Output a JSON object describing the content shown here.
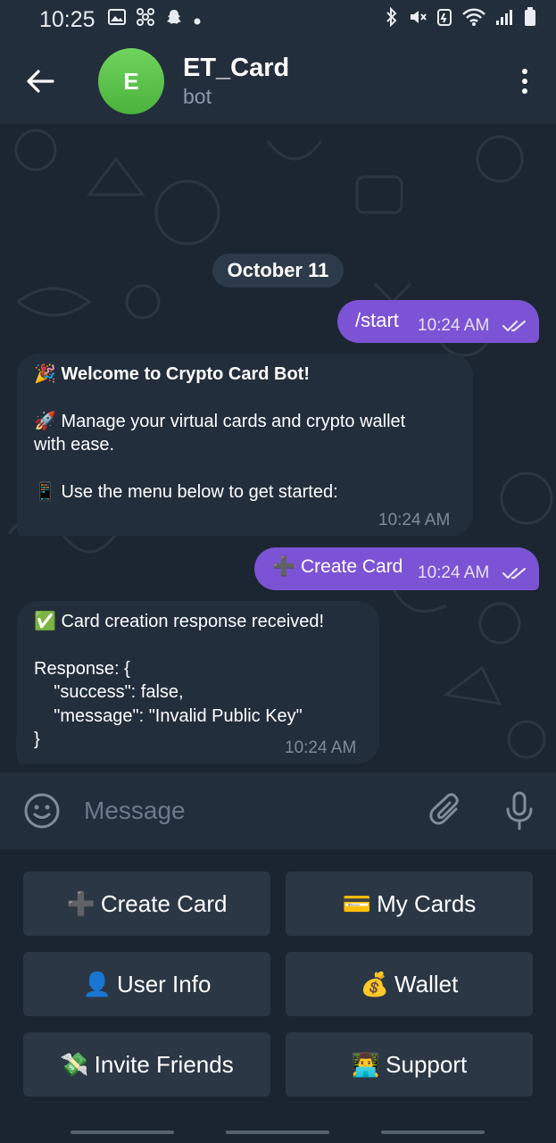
{
  "status_bar": {
    "time": "10:25",
    "left_icons": [
      "image-icon",
      "pinwheel-icon",
      "snapchat-icon",
      "dot-icon"
    ],
    "right_icons": [
      "bluetooth-icon",
      "mute-icon",
      "battery-saver-icon",
      "wifi-icon",
      "signal-icon",
      "battery-icon"
    ]
  },
  "header": {
    "avatar_letter": "E",
    "title": "ET_Card",
    "subtitle": "bot"
  },
  "chat": {
    "date": "October 11",
    "messages": [
      {
        "direction": "out",
        "text": "/start",
        "time": "10:24 AM",
        "status": "read"
      },
      {
        "direction": "in",
        "line1": "🎉 Welcome to Crypto Card Bot!",
        "line2": "🚀 Manage your virtual cards and crypto wallet",
        "line3": "with ease.",
        "line4": "📱 Use the menu below to get started:",
        "time": "10:24 AM"
      },
      {
        "direction": "out",
        "text": "➕ Create Card",
        "time": "10:24 AM",
        "status": "read"
      },
      {
        "direction": "in",
        "line1": "✅ Card creation response received!",
        "line2": "Response: {",
        "line3": "    \"success\": false,",
        "line4": "    \"message\": \"Invalid Public Key\"",
        "line5": "}",
        "time": "10:24 AM"
      }
    ]
  },
  "input": {
    "placeholder": "Message"
  },
  "keyboard": {
    "buttons": [
      {
        "emoji": "➕",
        "label": "Create Card"
      },
      {
        "emoji": "💳",
        "label": "My Cards"
      },
      {
        "emoji": "👤",
        "label": "User Info"
      },
      {
        "emoji": "💰",
        "label": "Wallet"
      },
      {
        "emoji": "💸",
        "label": "Invite Friends"
      },
      {
        "emoji": "👨‍💻",
        "label": "Support"
      }
    ]
  },
  "colors": {
    "outgoing_bubble": "#7c53d4",
    "incoming_bubble": "#232e3c",
    "avatar": "#5bc44a",
    "header": "#232e3c"
  }
}
